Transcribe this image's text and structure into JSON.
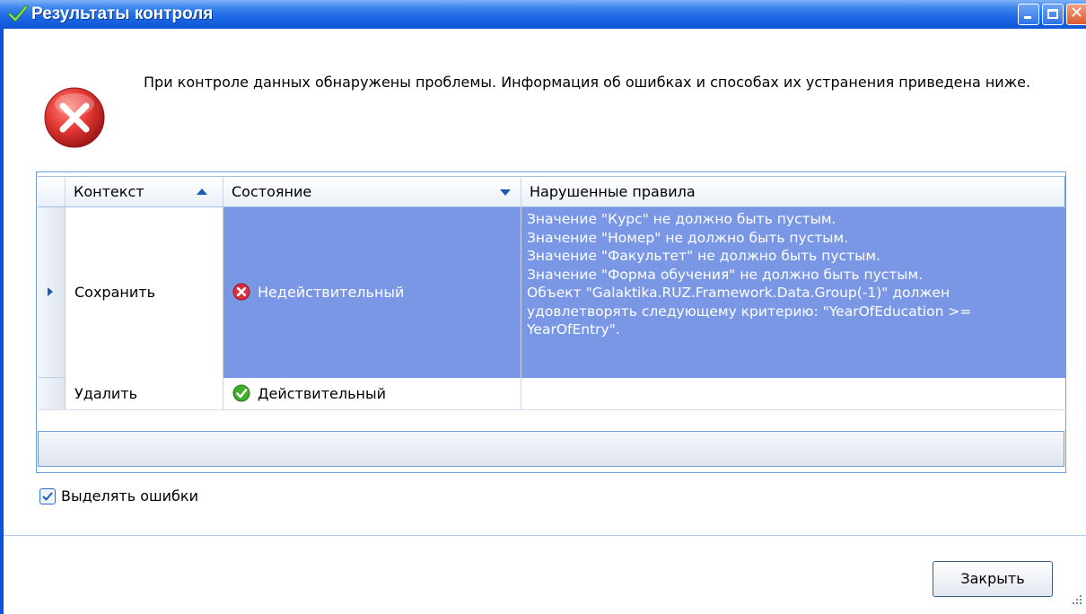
{
  "window": {
    "title": "Результаты контроля"
  },
  "message": "При контроле данных обнаружены проблемы. Информация об ошибках и способах их устранения приведена ниже.",
  "grid": {
    "columns": [
      "Контекст",
      "Состояние",
      "Нарушенные правила"
    ],
    "rows": [
      {
        "context": "Сохранить",
        "state": "Недействительный",
        "state_icon": "error-icon",
        "rules": "Значение \"Курс\" не должно быть пустым.\nЗначение \"Номер\" не должно быть пустым.\nЗначение \"Факультет\" не должно быть пустым.\nЗначение \"Форма обучения\" не должно быть пустым.\nОбъект \"Galaktika.RUZ.Framework.Data.Group(-1)\" должен удовлетворять следующему критерию: \"YearOfEducation >= YearOfEntry\".",
        "selected": true
      },
      {
        "context": "Удалить",
        "state": "Действительный",
        "state_icon": "check-icon",
        "rules": "",
        "selected": false
      }
    ]
  },
  "highlight_errors": {
    "label": "Выделять ошибки",
    "checked": true
  },
  "buttons": {
    "close": "Закрыть"
  },
  "colors": {
    "titlebar": "#1c68e5",
    "selection": "#7a97e6",
    "error": "#d8303a",
    "success": "#3fae2a"
  }
}
